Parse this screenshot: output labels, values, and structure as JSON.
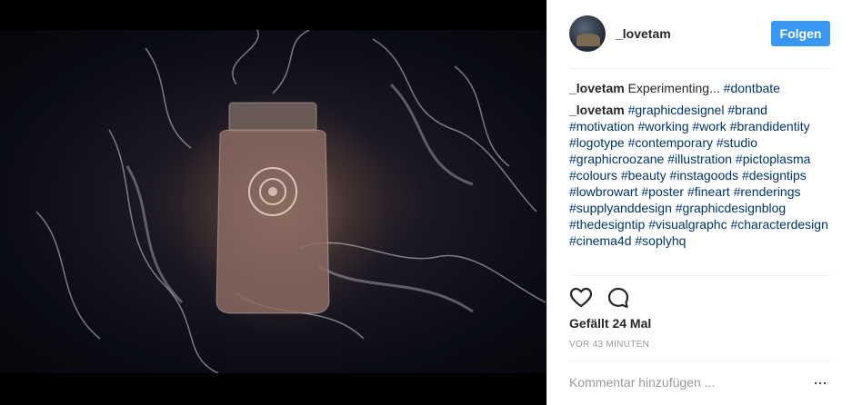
{
  "post": {
    "username": "_lovetam",
    "follow_label": "Folgen",
    "caption": {
      "author": "_lovetam",
      "text": "Experimenting...",
      "tags": [
        "#dontbate"
      ]
    },
    "comment": {
      "author": "_lovetam",
      "tags": [
        "#graphicdesignel",
        "#brand",
        "#motivation",
        "#working",
        "#work",
        "#brandidentity",
        "#logotype",
        "#contemporary",
        "#studio",
        "#graphicroozane",
        "#illustration",
        "#pictoplasma",
        "#colours",
        "#beauty",
        "#instagoods",
        "#designtips",
        "#lowbrowart",
        "#poster",
        "#fineart",
        "#renderings",
        "#supplyanddesign",
        "#graphicdesignblog",
        "#thedesigntip",
        "#visualgraphc",
        "#characterdesign",
        "#cinema4d",
        "#soplyhq"
      ]
    },
    "likes": "Gefällt 24 Mal",
    "time": "VOR 43 MINUTEN",
    "comment_placeholder": "Kommentar hinzufügen ...",
    "more_label": "...",
    "icons": {
      "like": "heart-icon",
      "comment": "comment-bubble-icon",
      "more": "more-options-icon"
    },
    "colors": {
      "follow_button": "#3897f0",
      "hashtag": "#003569",
      "media_background": "#000000"
    }
  }
}
